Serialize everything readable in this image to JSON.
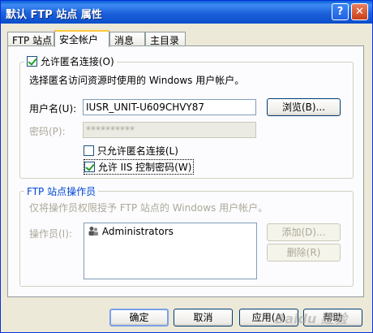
{
  "window": {
    "title": "默认 FTP 站点 属性",
    "help_label": "?",
    "close_label": "✕"
  },
  "tabs": [
    {
      "label": "FTP 站点",
      "active": false
    },
    {
      "label": "安全帐户",
      "active": true
    },
    {
      "label": "消息",
      "active": false
    },
    {
      "label": "主目录",
      "active": false
    }
  ],
  "anonymous": {
    "allow_checkbox_label": "允许匿名连接(O)",
    "allow_checked": true,
    "description": "选择匿名访问资源时使用的 Windows 用户帐户。",
    "username_label": "用户名(U):",
    "username_value": "IUSR_UNIT-U609CHVY87",
    "browse_label": "浏览(B)...",
    "password_label": "密码(P):",
    "password_value": "**********",
    "only_anonymous_label": "只允许匿名连接(L)",
    "only_anonymous_checked": false,
    "allow_iis_label": "允许 IIS 控制密码(W)",
    "allow_iis_checked": true
  },
  "operators": {
    "legend": "FTP 站点操作员",
    "description": "仅将操作员权限授予 FTP 站点的 Windows 用户帐户。",
    "operators_label": "操作员(I):",
    "list": [
      "Administrators"
    ],
    "add_label": "添加(D)...",
    "remove_label": "删除(R)"
  },
  "footer": {
    "ok_label": "确定",
    "cancel_label": "取消",
    "apply_label": "应用(A)",
    "help_label": "帮助"
  },
  "watermark": "Baidu 经验"
}
